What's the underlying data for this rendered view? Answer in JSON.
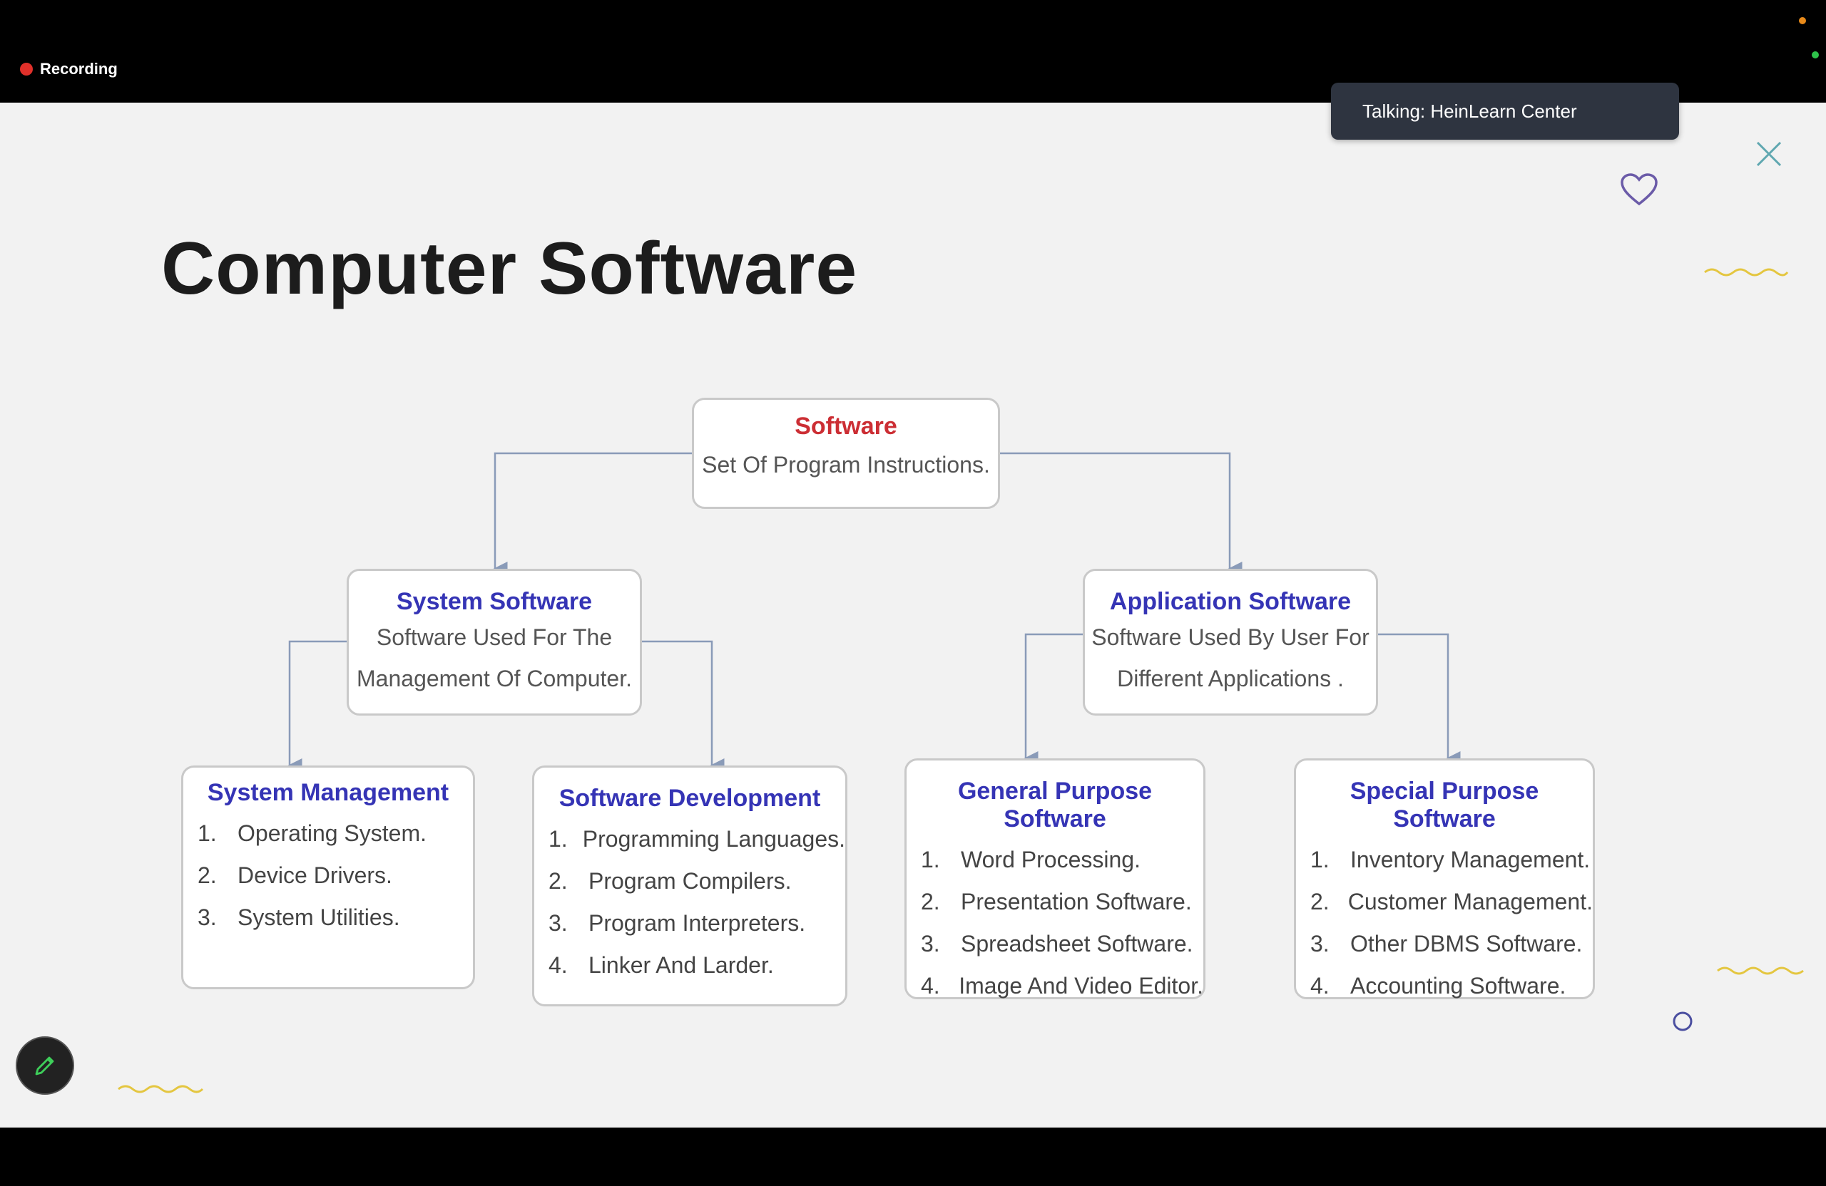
{
  "recording": {
    "label": "Recording"
  },
  "toast": {
    "text": "Talking: HeinLearn Center"
  },
  "slide": {
    "title": "Computer Software",
    "root": {
      "title": "Software",
      "desc": "Set Of Program Instructions."
    },
    "system": {
      "title": "System Software",
      "desc": [
        "Software Used For The",
        "Management Of Computer."
      ]
    },
    "application": {
      "title": "Application Software",
      "desc": [
        "Software Used By User For",
        "Different Applications ."
      ]
    },
    "leaves": [
      {
        "title": "System Management",
        "items": [
          "Operating System.",
          "Device Drivers.",
          "System Utilities."
        ]
      },
      {
        "title": "Software Development",
        "items": [
          "Programming Languages.",
          "Program Compilers.",
          "Program Interpreters.",
          "Linker And Larder."
        ]
      },
      {
        "title": "General Purpose Software",
        "items": [
          "Word Processing.",
          "Presentation Software.",
          "Spreadsheet Software.",
          "Image And Video Editor."
        ]
      },
      {
        "title": "Special Purpose Software",
        "items": [
          "Inventory Management.",
          "Customer Management.",
          "Other DBMS Software.",
          "Accounting Software."
        ]
      }
    ]
  },
  "colors": {
    "node_title": "#3534b5",
    "root_title": "#cc2e34",
    "connector": "#8a9bb8",
    "toast_bg": "#2e3440",
    "wave": "#e4c640"
  },
  "icons": {
    "close": "close-icon",
    "heart": "heart-icon",
    "pen": "pen-icon"
  }
}
